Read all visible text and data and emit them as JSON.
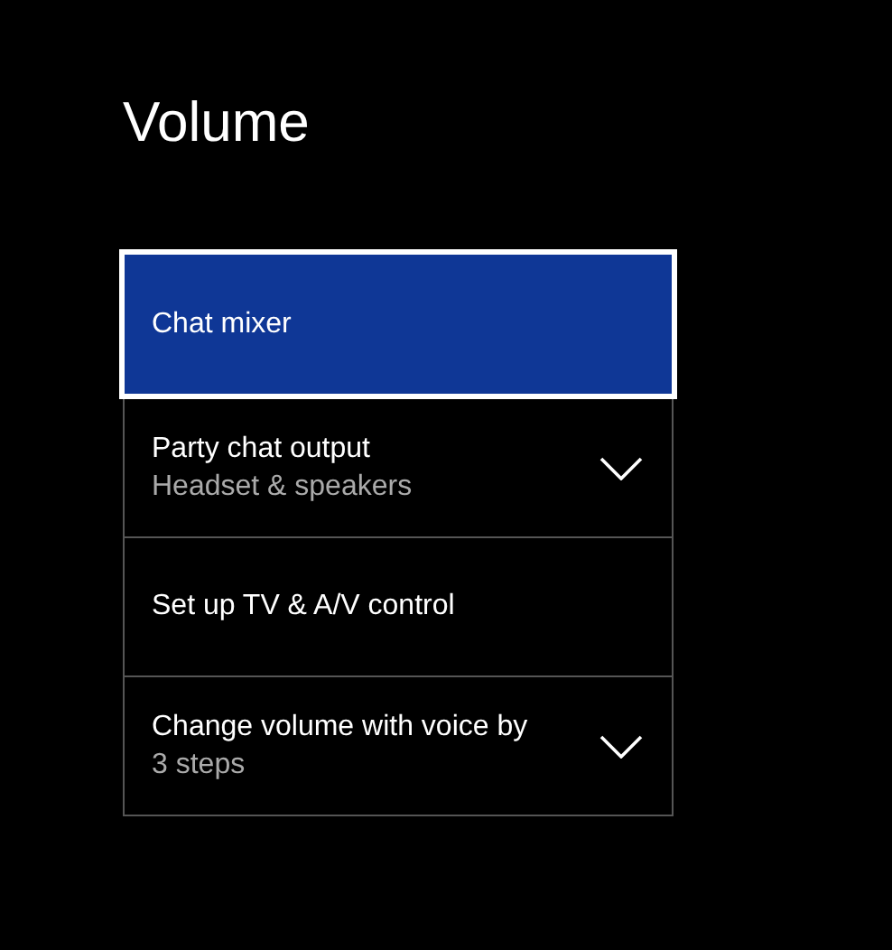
{
  "page": {
    "title": "Volume"
  },
  "items": [
    {
      "kind": "button",
      "label": "Chat mixer",
      "selected": true
    },
    {
      "kind": "dropdown",
      "label": "Party chat output",
      "value": "Headset & speakers",
      "selected": false
    },
    {
      "kind": "button",
      "label": "Set up TV & A/V control",
      "selected": false
    },
    {
      "kind": "dropdown",
      "label": "Change volume with voice by",
      "value": "3 steps",
      "selected": false
    }
  ]
}
